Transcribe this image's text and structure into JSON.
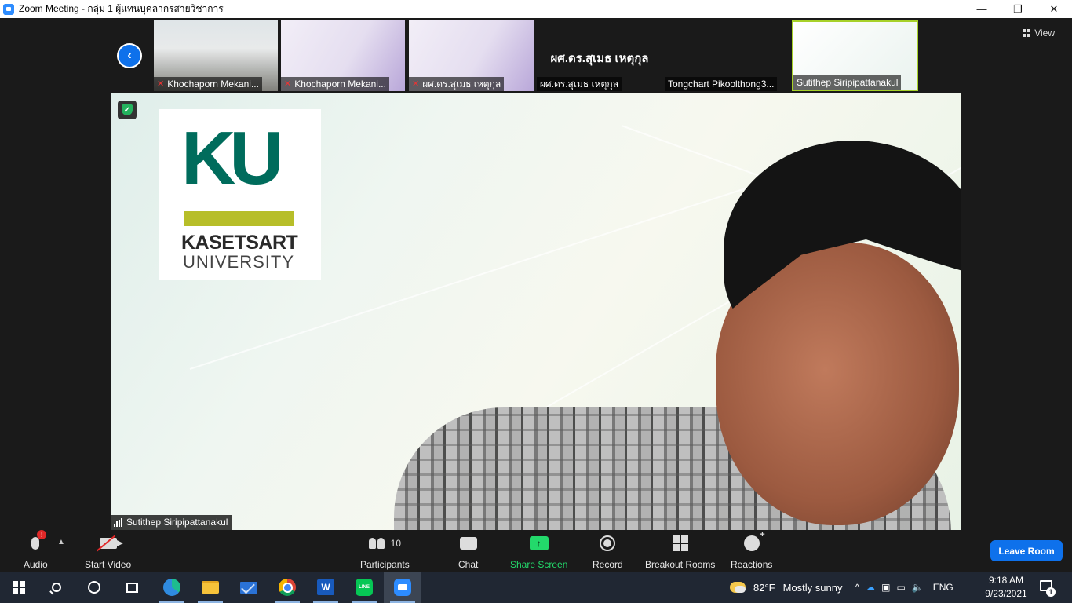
{
  "window": {
    "title": "Zoom Meeting - กลุ่ม 1 ผู้แทนบุคลากรสายวิชาการ",
    "minimize": "—",
    "restore": "❐",
    "close": "✕"
  },
  "strip": {
    "view_label": "View",
    "thumbnails": [
      {
        "name": "Khochaporn Mekani...",
        "muted": true
      },
      {
        "name": "Khochaporn Mekani...",
        "muted": true
      },
      {
        "name": "ผศ.ดร.สุเมธ เหตุกุล",
        "muted": true
      },
      {
        "name": "ผศ.ดร.สุเมธ เหตุกุล",
        "muted": false,
        "display_name": "ผศ.ดร.สุเมธ เหตุกุล"
      },
      {
        "name": "Tongchart Pikoolthong3...",
        "muted": false
      },
      {
        "name": "Sutithep Siripipattanakul",
        "muted": false,
        "active": true
      }
    ]
  },
  "main": {
    "speaker_name": "Sutithep Siripipattanakul",
    "logo": {
      "mark": "KU",
      "line1": "KASETSART",
      "line2": "UNIVERSITY"
    }
  },
  "toolbar": {
    "audio_label": "Audio",
    "audio_alert": "!",
    "video_label": "Start Video",
    "participants_label": "Participants",
    "participants_count": "10",
    "chat_label": "Chat",
    "share_label": "Share Screen",
    "share_glyph": "↑",
    "record_label": "Record",
    "breakout_label": "Breakout Rooms",
    "reactions_label": "Reactions",
    "leave_label": "Leave Room"
  },
  "taskbar": {
    "word_glyph": "W",
    "line_glyph": "LINE",
    "weather_temp": "82°F",
    "weather_text": "Mostly sunny",
    "language": "ENG",
    "time": "9:18 AM",
    "date": "9/23/2021",
    "notification_count": "1",
    "tray_caret": "^",
    "volume_glyph": "🔈"
  },
  "colors": {
    "zoom_blue": "#0E71EB",
    "share_green": "#23D96B",
    "ku_green": "#006C5C",
    "ku_olive": "#B7BE29"
  }
}
